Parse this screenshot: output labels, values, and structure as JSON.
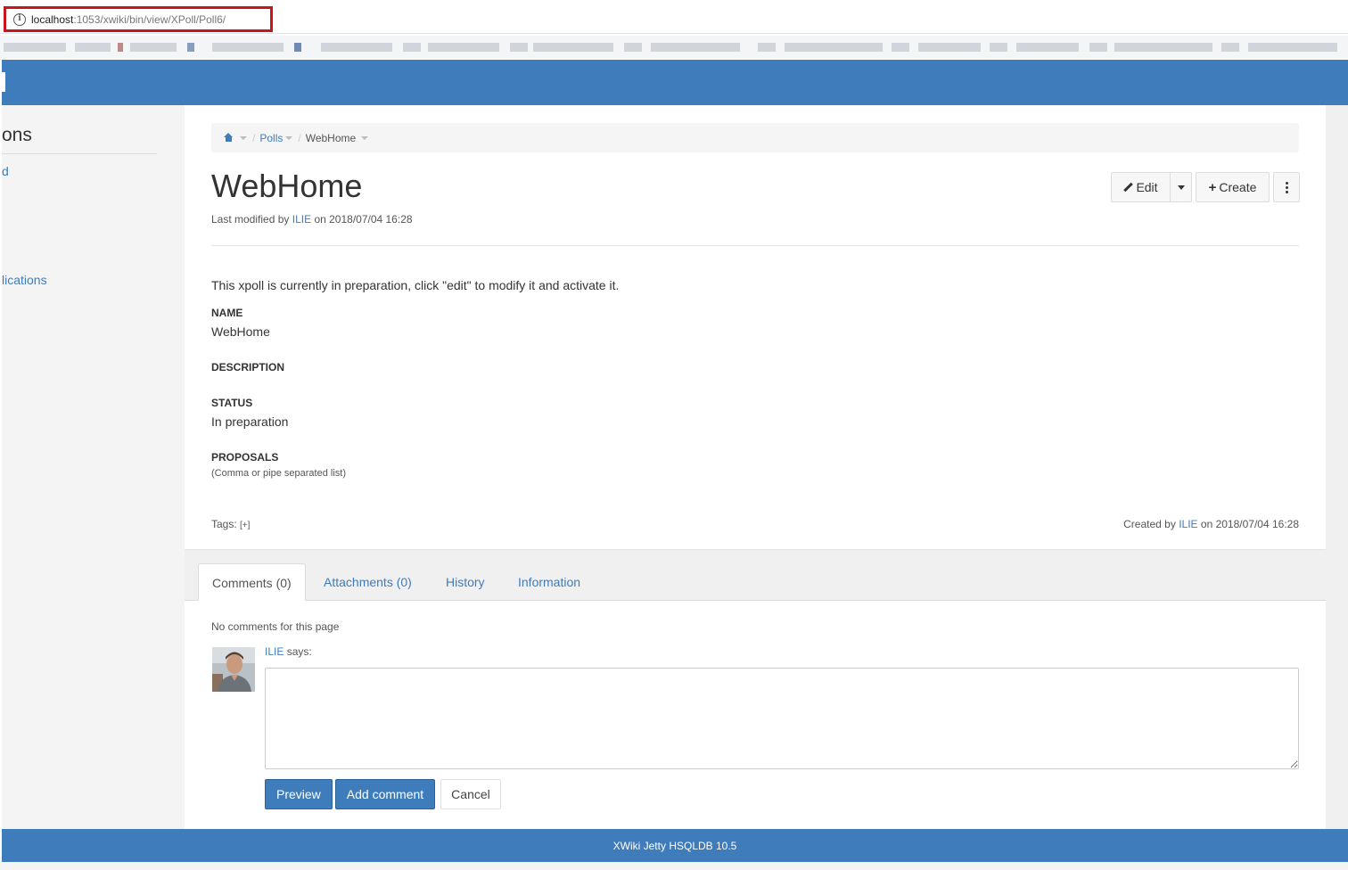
{
  "browser": {
    "url_host": "localhost",
    "url_path": ":1053/xwiki/bin/view/XPoll/Poll6/"
  },
  "sidebar": {
    "title": "ons",
    "link_1": "d",
    "link_2": "lications"
  },
  "breadcrumb": {
    "items": [
      "Polls",
      "WebHome"
    ]
  },
  "page": {
    "title": "WebHome",
    "modified_prefix": "Last modified by",
    "modified_user": "ILIE",
    "modified_suffix": "on 2018/07/04 16:28"
  },
  "toolbar": {
    "edit_label": "Edit",
    "create_label": "Create"
  },
  "content": {
    "intro": "This xpoll is currently in preparation, click \"edit\" to modify it and activate it.",
    "fields": {
      "name_label": "NAME",
      "name_value": "WebHome",
      "description_label": "DESCRIPTION",
      "status_label": "STATUS",
      "status_value": "In preparation",
      "proposals_label": "PROPOSALS",
      "proposals_hint": "(Comma or pipe separated list)"
    }
  },
  "meta": {
    "tags_label": "Tags:",
    "tags_add": "[+]",
    "created_prefix": "Created by",
    "created_user": "ILIE",
    "created_suffix": "on 2018/07/04 16:28"
  },
  "tabs": [
    {
      "label": "Comments (0)"
    },
    {
      "label": "Attachments (0)"
    },
    {
      "label": "History"
    },
    {
      "label": "Information"
    }
  ],
  "comments": {
    "empty_text": "No comments for this page",
    "user": "ILIE",
    "says": "says:",
    "preview_label": "Preview",
    "add_label": "Add comment",
    "cancel_label": "Cancel"
  },
  "footer": {
    "text": "XWiki Jetty HSQLDB 10.5"
  },
  "colors": {
    "brand": "#3e7cbc",
    "highlight_border": "#c8161d"
  }
}
